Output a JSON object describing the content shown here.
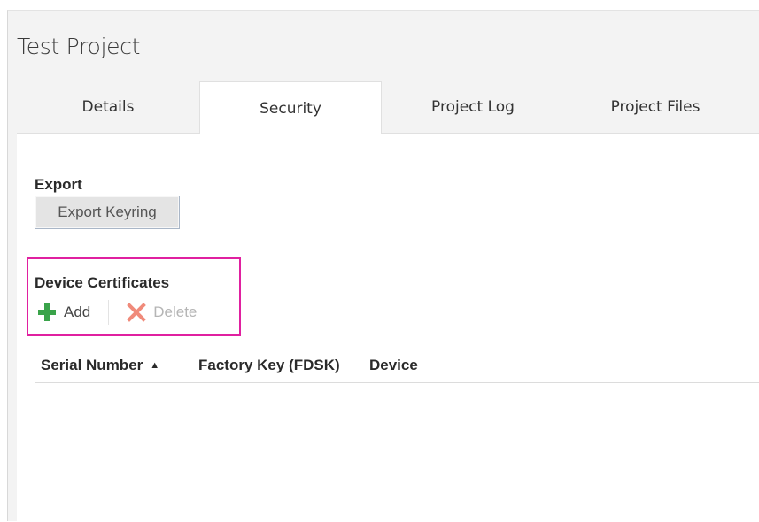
{
  "window": {
    "title": "Test Project"
  },
  "tabs": [
    {
      "label": "Details",
      "active": false
    },
    {
      "label": "Security",
      "active": true
    },
    {
      "label": "Project Log",
      "active": false
    },
    {
      "label": "Project Files",
      "active": false
    }
  ],
  "export": {
    "section_label": "Export",
    "button_label": "Export Keyring"
  },
  "device_certificates": {
    "section_label": "Device Certificates",
    "add_label": "Add",
    "delete_label": "Delete",
    "highlight_color": "#e020a0",
    "columns": [
      {
        "label": "Serial Number",
        "sort": "ascending"
      },
      {
        "label": "Factory Key (FDSK)"
      },
      {
        "label": "Device"
      }
    ],
    "rows": []
  },
  "icons": {
    "add": "plus-icon",
    "delete": "x-icon",
    "sort": "sort-ascending-icon"
  },
  "colors": {
    "add_icon": "#3aa34a",
    "delete_icon": "#f08a7a",
    "delete_text_disabled": "#b5b5b5"
  }
}
